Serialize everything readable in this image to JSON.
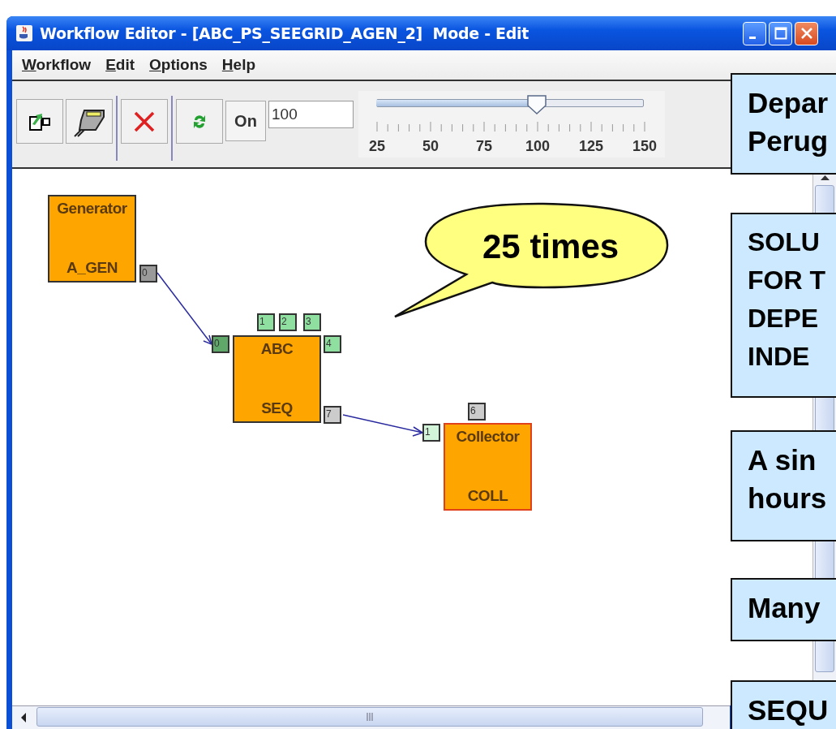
{
  "window": {
    "title": "Workflow Editor - [ABC_PS_SEEGRID_AGEN_2]  Mode - Edit"
  },
  "menu": [
    "Workflow",
    "Edit",
    "Options",
    "Help"
  ],
  "toolbar": {
    "on_button": "On",
    "speed_field": {
      "value": "100"
    },
    "slider": {
      "level": 0.6,
      "labels": [
        "25",
        "50",
        "75",
        "100",
        "125",
        "150"
      ]
    }
  },
  "diagram": {
    "nodes": [
      {
        "title": "Generator",
        "name": "A_GEN",
        "color": "#333333",
        "ports": [
          {
            "label": "0",
            "color": "#9a9a9a"
          }
        ]
      },
      {
        "title": "ABC",
        "name": "SEQ",
        "color": "#333333",
        "ports": [
          {
            "label": "0",
            "color": "#5fa86a"
          },
          {
            "label": "1",
            "color": "#8fe0a0"
          },
          {
            "label": "2",
            "color": "#8fe0a0"
          },
          {
            "label": "3",
            "color": "#8fe0a0"
          },
          {
            "label": "4",
            "color": "#8fe0a0"
          },
          {
            "label": "7",
            "color": "#cccccc"
          }
        ]
      },
      {
        "title": "Collector",
        "name": "COLL",
        "color": "#e0401a",
        "ports": [
          {
            "label": "6",
            "color": "#cccccc"
          },
          {
            "label": "1",
            "color": "#d2f5da"
          }
        ]
      }
    ],
    "callout": "25 times"
  },
  "notes": [
    {
      "lines": [
        "Depar",
        "Perug"
      ]
    },
    {
      "lines": [
        "SOLU",
        "FOR T",
        "DEPE",
        "INDE"
      ]
    },
    {
      "lines": [
        "A sin",
        "hours"
      ]
    },
    {
      "lines": [
        "Many"
      ]
    },
    {
      "lines": [
        "SEQU"
      ]
    }
  ]
}
